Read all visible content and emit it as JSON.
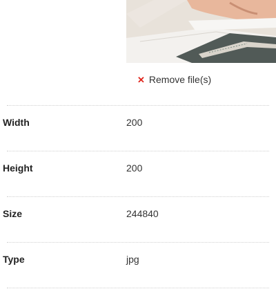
{
  "preview": {
    "icon": "image-thumbnail"
  },
  "remove": {
    "icon": "close-icon",
    "label": "Remove file(s)",
    "color": "#e0241b"
  },
  "details": [
    {
      "label": "Width",
      "value": "200"
    },
    {
      "label": "Height",
      "value": "200"
    },
    {
      "label": "Size",
      "value": "244840"
    },
    {
      "label": "Type",
      "value": "jpg"
    }
  ]
}
